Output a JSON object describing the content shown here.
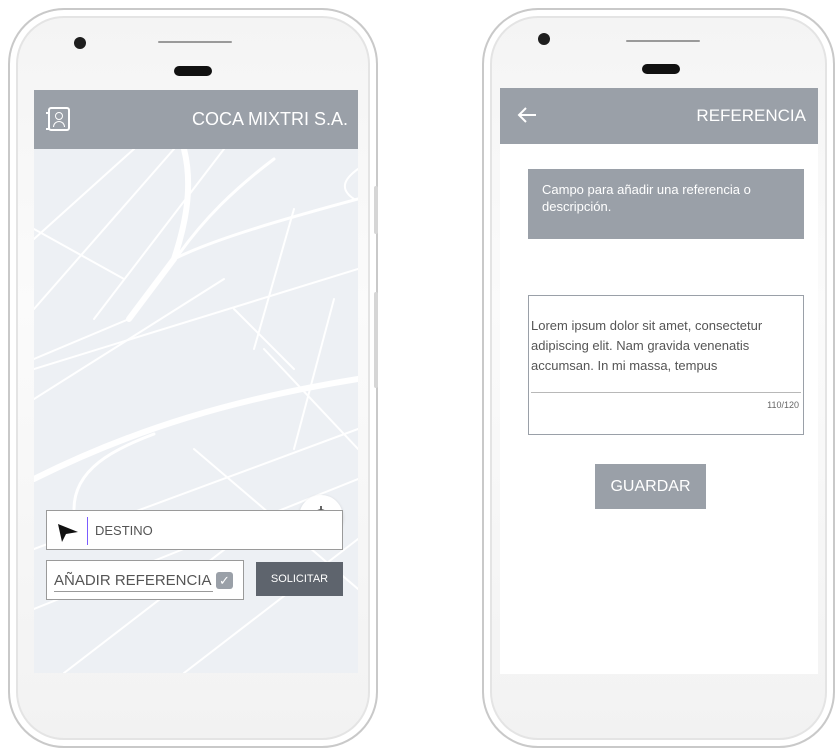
{
  "left_screen": {
    "header": {
      "title": "COCA MIXTRI S.A.",
      "icon": "contacts-book-icon"
    },
    "map": {
      "locate_icon": "locate-target-icon"
    },
    "destino": {
      "placeholder": "DESTINO",
      "icon": "navigation-arrow-icon"
    },
    "referencia": {
      "label": "AÑADIR REFERENCIA",
      "checked": true,
      "check_glyph": "✓"
    },
    "solicitar_label": "SOLICITAR"
  },
  "right_screen": {
    "header": {
      "title": "REFERENCIA",
      "back_icon": "back-arrow-icon"
    },
    "info_text": "Campo para añadir una  referencia o descripción.",
    "textarea": {
      "value": "Lorem ipsum dolor sit amet, consectetur adipiscing elit. Nam gravida venenatis accumsan. In mi massa, tempus",
      "counter": "110/120"
    },
    "guardar_label": "GUARDAR"
  },
  "colors": {
    "header": "#9aa0a8",
    "button_dark": "#5e646d",
    "map_bg": "#edf0f4",
    "map_roads": "#ffffff"
  }
}
